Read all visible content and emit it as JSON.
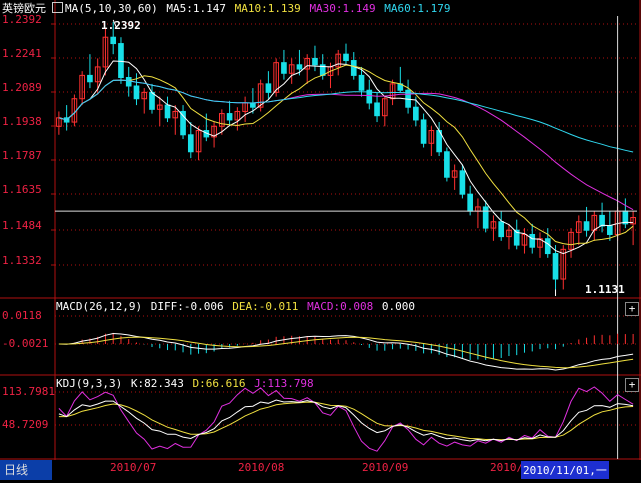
{
  "header": {
    "symbol": "英镑欧元",
    "ma_params": "MA(5,10,30,60)",
    "ma5": "MA5:1.147",
    "ma10": "MA10:1.139",
    "ma30": "MA30:1.149",
    "ma60": "MA60:1.179"
  },
  "macd_header": {
    "params": "MACD(26,12,9)",
    "diff": "DIFF:-0.006",
    "dea": "DEA:-0.011",
    "macd": "MACD:0.008",
    "extra": "0.000"
  },
  "kdj_header": {
    "params": "KDJ(9,3,3)",
    "k": "K:82.343",
    "d": "D:66.616",
    "j": "J:113.798"
  },
  "price_axis": [
    "1.2392",
    "1.2241",
    "1.2089",
    "1.1938",
    "1.1787",
    "1.1635",
    "1.1484",
    "1.1332"
  ],
  "macd_axis": [
    "0.0118",
    "-0.0021"
  ],
  "kdj_axis": [
    "113.7981",
    "48.7209"
  ],
  "x_axis": [
    "2010/07",
    "2010/08",
    "2010/09",
    "2010/"
  ],
  "annotations": {
    "high": "1.2392",
    "low": "1.1131"
  },
  "cursor_date": "2010/11/01,一",
  "period_tab": "日线",
  "colors": {
    "up": "#ff3030",
    "down": "#18e0e8",
    "ma5": "#ffffff",
    "ma10": "#f0e040",
    "ma30": "#e030e0",
    "ma60": "#30d8f0",
    "axis": "#b01010"
  },
  "chart_data": {
    "type": "candlestick",
    "ylim": [
      1.11,
      1.242
    ],
    "candles": [
      [
        1.19,
        1.197,
        1.186,
        1.194
      ],
      [
        1.194,
        1.2,
        1.188,
        1.192
      ],
      [
        1.192,
        1.205,
        1.19,
        1.203
      ],
      [
        1.203,
        1.216,
        1.2,
        1.214
      ],
      [
        1.214,
        1.224,
        1.208,
        1.211
      ],
      [
        1.211,
        1.222,
        1.205,
        1.218
      ],
      [
        1.218,
        1.236,
        1.214,
        1.232
      ],
      [
        1.232,
        1.2392,
        1.224,
        1.229
      ],
      [
        1.229,
        1.232,
        1.21,
        1.213
      ],
      [
        1.213,
        1.218,
        1.204,
        1.209
      ],
      [
        1.209,
        1.215,
        1.2,
        1.203
      ],
      [
        1.203,
        1.208,
        1.196,
        1.206
      ],
      [
        1.206,
        1.21,
        1.196,
        1.198
      ],
      [
        1.198,
        1.204,
        1.19,
        1.2
      ],
      [
        1.2,
        1.204,
        1.192,
        1.194
      ],
      [
        1.194,
        1.2,
        1.186,
        1.197
      ],
      [
        1.197,
        1.2,
        1.184,
        1.186
      ],
      [
        1.186,
        1.192,
        1.175,
        1.178
      ],
      [
        1.178,
        1.19,
        1.174,
        1.188
      ],
      [
        1.188,
        1.196,
        1.183,
        1.185
      ],
      [
        1.185,
        1.192,
        1.18,
        1.19
      ],
      [
        1.19,
        1.198,
        1.186,
        1.196
      ],
      [
        1.196,
        1.202,
        1.19,
        1.193
      ],
      [
        1.193,
        1.199,
        1.188,
        1.197
      ],
      [
        1.197,
        1.204,
        1.192,
        1.201
      ],
      [
        1.201,
        1.208,
        1.196,
        1.199
      ],
      [
        1.199,
        1.212,
        1.197,
        1.21
      ],
      [
        1.21,
        1.216,
        1.203,
        1.206
      ],
      [
        1.206,
        1.222,
        1.204,
        1.22
      ],
      [
        1.22,
        1.226,
        1.212,
        1.215
      ],
      [
        1.215,
        1.222,
        1.21,
        1.219
      ],
      [
        1.219,
        1.226,
        1.214,
        1.217
      ],
      [
        1.217,
        1.224,
        1.21,
        1.222
      ],
      [
        1.222,
        1.228,
        1.216,
        1.219
      ],
      [
        1.219,
        1.224,
        1.212,
        1.214
      ],
      [
        1.214,
        1.22,
        1.208,
        1.218
      ],
      [
        1.218,
        1.226,
        1.214,
        1.224
      ],
      [
        1.224,
        1.229,
        1.219,
        1.221
      ],
      [
        1.221,
        1.225,
        1.212,
        1.214
      ],
      [
        1.214,
        1.218,
        1.204,
        1.207
      ],
      [
        1.207,
        1.212,
        1.198,
        1.201
      ],
      [
        1.201,
        1.206,
        1.192,
        1.195
      ],
      [
        1.195,
        1.204,
        1.19,
        1.203
      ],
      [
        1.203,
        1.212,
        1.2,
        1.21
      ],
      [
        1.21,
        1.218,
        1.206,
        1.207
      ],
      [
        1.207,
        1.212,
        1.196,
        1.199
      ],
      [
        1.199,
        1.204,
        1.19,
        1.193
      ],
      [
        1.193,
        1.196,
        1.18,
        1.182
      ],
      [
        1.182,
        1.19,
        1.176,
        1.188
      ],
      [
        1.188,
        1.192,
        1.176,
        1.178
      ],
      [
        1.178,
        1.18,
        1.164,
        1.166
      ],
      [
        1.166,
        1.172,
        1.16,
        1.169
      ],
      [
        1.169,
        1.172,
        1.156,
        1.158
      ],
      [
        1.158,
        1.162,
        1.148,
        1.15
      ],
      [
        1.15,
        1.156,
        1.142,
        1.152
      ],
      [
        1.152,
        1.155,
        1.14,
        1.142
      ],
      [
        1.142,
        1.148,
        1.136,
        1.145
      ],
      [
        1.145,
        1.15,
        1.136,
        1.138
      ],
      [
        1.138,
        1.144,
        1.132,
        1.141
      ],
      [
        1.141,
        1.146,
        1.132,
        1.134
      ],
      [
        1.134,
        1.142,
        1.13,
        1.139
      ],
      [
        1.139,
        1.144,
        1.13,
        1.133
      ],
      [
        1.133,
        1.14,
        1.128,
        1.137
      ],
      [
        1.137,
        1.142,
        1.128,
        1.13
      ],
      [
        1.13,
        1.134,
        1.1131,
        1.118
      ],
      [
        1.118,
        1.134,
        1.1131,
        1.132
      ],
      [
        1.132,
        1.142,
        1.128,
        1.14
      ],
      [
        1.14,
        1.148,
        1.134,
        1.145
      ],
      [
        1.145,
        1.152,
        1.138,
        1.141
      ],
      [
        1.141,
        1.15,
        1.136,
        1.148
      ],
      [
        1.148,
        1.154,
        1.14,
        1.143
      ],
      [
        1.143,
        1.15,
        1.136,
        1.139
      ],
      [
        1.139,
        1.152,
        1.136,
        1.15
      ],
      [
        1.15,
        1.156,
        1.142,
        1.144
      ],
      [
        1.144,
        1.15,
        1.134,
        1.147
      ]
    ]
  }
}
